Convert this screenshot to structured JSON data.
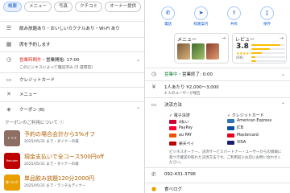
{
  "left": {
    "chips": [
      "概要",
      "メニュー",
      "写真",
      "クチコミ",
      "オーナー提供"
    ],
    "feature_line": "飲み放題あり・おいしいカクテルあり・Wi-Fi あり",
    "reserve_label": "席を予約します",
    "status_closed": "営業時間外",
    "hours_open": "・営業開始: 17:00",
    "hours_note": "このビジネスによって確認済み (3 週間前)",
    "credit_card": "クレジットカード",
    "menu_label": "メニュー",
    "coupon_label": "クーポン (6)",
    "coupon_section_label": "クーポンのご利用について",
    "coupons": [
      {
        "title": "予約の場合会計から5%オフ",
        "meta": "2025/05/31 まで・ダイナーの森",
        "thumb_text": "トリキ",
        "color": "#8d6e63"
      },
      {
        "title": "現金支払いで全コース500円off",
        "meta": "2025/05/31 まで・ダイナーの森",
        "thumb_text": "Rakuten",
        "color": "#bf0000"
      },
      {
        "title": "単品飲み放題120分2000円",
        "meta": "2025/05/31 まで・ランチ＆ディナー",
        "thumb_text": "食べログ",
        "color": "#e8a000"
      }
    ]
  },
  "right": {
    "actions": [
      {
        "label": "電話",
        "icon": "phone-icon",
        "glyph": "✆"
      },
      {
        "label": "経路案内",
        "icon": "directions-icon",
        "glyph": "➤"
      },
      {
        "label": "共有",
        "icon": "share-icon",
        "glyph": "⇪"
      },
      {
        "label": "保存",
        "icon": "bookmark-icon",
        "glyph": "▯"
      }
    ],
    "menu_card_title": "メニュー",
    "review_card_title": "レビュー",
    "rating": "3.8",
    "stars": "★★★★☆",
    "review_count": "(66)",
    "rating_distribution": [
      0.85,
      0.55,
      0.3,
      0.12,
      0.15
    ],
    "status_closed": "営業中",
    "status_tail": "・営業終了: 0:00",
    "price": "1人あたり ¥2,000～3,000",
    "price_note": "4 人のユーザーが報告",
    "payment_title": "決済方法",
    "payment_col1_head": "電子決済",
    "payment_col2_head": "クレジットカード",
    "payment_col1": [
      {
        "name": "d払い",
        "color": "#cc0033"
      },
      {
        "name": "PayPay",
        "color": "#ff0033"
      },
      {
        "name": "au PAY",
        "color": "#eb5505"
      },
      {
        "name": "楽天ペイ",
        "color": "#bf0000"
      }
    ],
    "payment_col2": [
      {
        "name": "American Express",
        "color": "#2e77bb"
      },
      {
        "name": "JCB",
        "color": "#0b4ea2"
      },
      {
        "name": "Mastercard",
        "color": "#eb001b"
      },
      {
        "name": "VISA",
        "color": "#1a1f71"
      }
    ],
    "payment_note": "ビジネスオーナー、決済サービスパートナー・ユーザーからの情報に基づき確認の取れた決済方法です。ご利用前にお店にお問い合わせください。",
    "phone": "092-431-3796",
    "tabelog_label": "食べログ"
  }
}
